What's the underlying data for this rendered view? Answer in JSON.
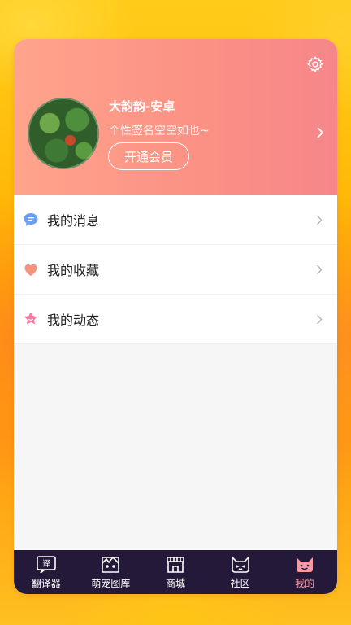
{
  "profile": {
    "username": "大韵韵-安卓",
    "signature": "个性签名空空如也~",
    "vip_button": "开通会员"
  },
  "menu": {
    "items": [
      {
        "label": "我的消息",
        "icon": "message-icon",
        "color": "#6aa0f5"
      },
      {
        "label": "我的收藏",
        "icon": "heart-icon",
        "color": "#f6917b"
      },
      {
        "label": "我的动态",
        "icon": "flower-icon",
        "color": "#f47aa0"
      }
    ]
  },
  "tabbar": {
    "items": [
      {
        "label": "翻译器",
        "icon": "translator-icon",
        "active": false
      },
      {
        "label": "萌宠图库",
        "icon": "pet-gallery-icon",
        "active": false
      },
      {
        "label": "商城",
        "icon": "shop-icon",
        "active": false
      },
      {
        "label": "社区",
        "icon": "cat-community-icon",
        "active": false
      },
      {
        "label": "我的",
        "icon": "me-icon",
        "active": true
      }
    ]
  },
  "colors": {
    "header_start": "#ffa48c",
    "header_end": "#f6868a",
    "tabbar_bg": "#25193a",
    "tab_active": "#f59aa2"
  }
}
